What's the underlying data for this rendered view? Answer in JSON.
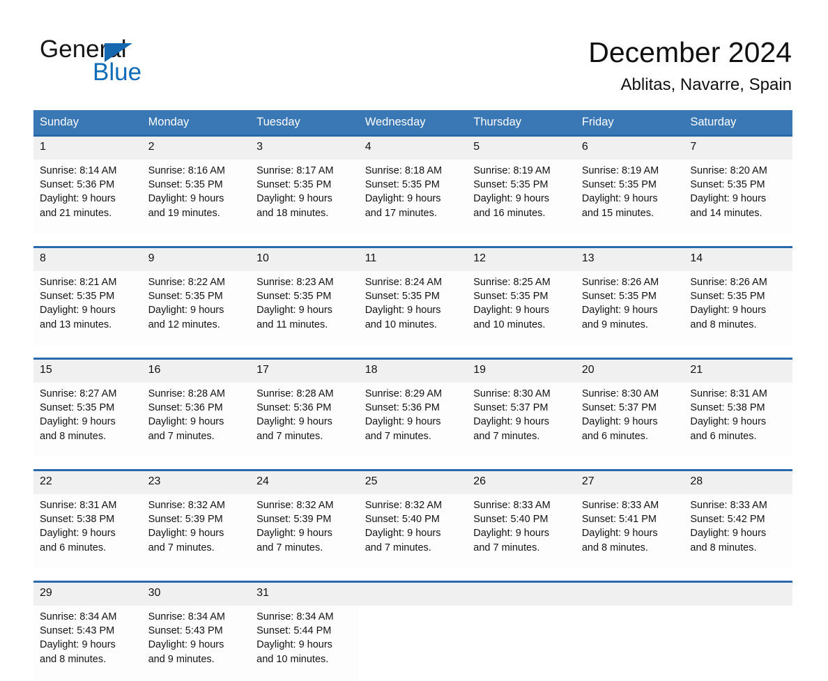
{
  "brand": {
    "name_part1": "General",
    "name_part2": "Blue",
    "triangle_color": "#1568b0",
    "blue_color": "#0f6cb8"
  },
  "header": {
    "title": "December 2024",
    "location": "Ablitas, Navarre, Spain"
  },
  "theme": {
    "header_row_bg": "#3a77b5",
    "week_separator": "#2869ab",
    "daynum_band_bg": "#f0f0f0",
    "cell_bg": "#fdfdfd",
    "text": "#121212"
  },
  "weekdays": [
    "Sunday",
    "Monday",
    "Tuesday",
    "Wednesday",
    "Thursday",
    "Friday",
    "Saturday"
  ],
  "weeks": [
    {
      "days": [
        {
          "date": "1",
          "sunrise": "Sunrise: 8:14 AM",
          "sunset": "Sunset: 5:36 PM",
          "daylight_line1": "Daylight: 9 hours",
          "daylight_line2": "and 21 minutes."
        },
        {
          "date": "2",
          "sunrise": "Sunrise: 8:16 AM",
          "sunset": "Sunset: 5:35 PM",
          "daylight_line1": "Daylight: 9 hours",
          "daylight_line2": "and 19 minutes."
        },
        {
          "date": "3",
          "sunrise": "Sunrise: 8:17 AM",
          "sunset": "Sunset: 5:35 PM",
          "daylight_line1": "Daylight: 9 hours",
          "daylight_line2": "and 18 minutes."
        },
        {
          "date": "4",
          "sunrise": "Sunrise: 8:18 AM",
          "sunset": "Sunset: 5:35 PM",
          "daylight_line1": "Daylight: 9 hours",
          "daylight_line2": "and 17 minutes."
        },
        {
          "date": "5",
          "sunrise": "Sunrise: 8:19 AM",
          "sunset": "Sunset: 5:35 PM",
          "daylight_line1": "Daylight: 9 hours",
          "daylight_line2": "and 16 minutes."
        },
        {
          "date": "6",
          "sunrise": "Sunrise: 8:19 AM",
          "sunset": "Sunset: 5:35 PM",
          "daylight_line1": "Daylight: 9 hours",
          "daylight_line2": "and 15 minutes."
        },
        {
          "date": "7",
          "sunrise": "Sunrise: 8:20 AM",
          "sunset": "Sunset: 5:35 PM",
          "daylight_line1": "Daylight: 9 hours",
          "daylight_line2": "and 14 minutes."
        }
      ]
    },
    {
      "days": [
        {
          "date": "8",
          "sunrise": "Sunrise: 8:21 AM",
          "sunset": "Sunset: 5:35 PM",
          "daylight_line1": "Daylight: 9 hours",
          "daylight_line2": "and 13 minutes."
        },
        {
          "date": "9",
          "sunrise": "Sunrise: 8:22 AM",
          "sunset": "Sunset: 5:35 PM",
          "daylight_line1": "Daylight: 9 hours",
          "daylight_line2": "and 12 minutes."
        },
        {
          "date": "10",
          "sunrise": "Sunrise: 8:23 AM",
          "sunset": "Sunset: 5:35 PM",
          "daylight_line1": "Daylight: 9 hours",
          "daylight_line2": "and 11 minutes."
        },
        {
          "date": "11",
          "sunrise": "Sunrise: 8:24 AM",
          "sunset": "Sunset: 5:35 PM",
          "daylight_line1": "Daylight: 9 hours",
          "daylight_line2": "and 10 minutes."
        },
        {
          "date": "12",
          "sunrise": "Sunrise: 8:25 AM",
          "sunset": "Sunset: 5:35 PM",
          "daylight_line1": "Daylight: 9 hours",
          "daylight_line2": "and 10 minutes."
        },
        {
          "date": "13",
          "sunrise": "Sunrise: 8:26 AM",
          "sunset": "Sunset: 5:35 PM",
          "daylight_line1": "Daylight: 9 hours",
          "daylight_line2": "and 9 minutes."
        },
        {
          "date": "14",
          "sunrise": "Sunrise: 8:26 AM",
          "sunset": "Sunset: 5:35 PM",
          "daylight_line1": "Daylight: 9 hours",
          "daylight_line2": "and 8 minutes."
        }
      ]
    },
    {
      "days": [
        {
          "date": "15",
          "sunrise": "Sunrise: 8:27 AM",
          "sunset": "Sunset: 5:35 PM",
          "daylight_line1": "Daylight: 9 hours",
          "daylight_line2": "and 8 minutes."
        },
        {
          "date": "16",
          "sunrise": "Sunrise: 8:28 AM",
          "sunset": "Sunset: 5:36 PM",
          "daylight_line1": "Daylight: 9 hours",
          "daylight_line2": "and 7 minutes."
        },
        {
          "date": "17",
          "sunrise": "Sunrise: 8:28 AM",
          "sunset": "Sunset: 5:36 PM",
          "daylight_line1": "Daylight: 9 hours",
          "daylight_line2": "and 7 minutes."
        },
        {
          "date": "18",
          "sunrise": "Sunrise: 8:29 AM",
          "sunset": "Sunset: 5:36 PM",
          "daylight_line1": "Daylight: 9 hours",
          "daylight_line2": "and 7 minutes."
        },
        {
          "date": "19",
          "sunrise": "Sunrise: 8:30 AM",
          "sunset": "Sunset: 5:37 PM",
          "daylight_line1": "Daylight: 9 hours",
          "daylight_line2": "and 7 minutes."
        },
        {
          "date": "20",
          "sunrise": "Sunrise: 8:30 AM",
          "sunset": "Sunset: 5:37 PM",
          "daylight_line1": "Daylight: 9 hours",
          "daylight_line2": "and 6 minutes."
        },
        {
          "date": "21",
          "sunrise": "Sunrise: 8:31 AM",
          "sunset": "Sunset: 5:38 PM",
          "daylight_line1": "Daylight: 9 hours",
          "daylight_line2": "and 6 minutes."
        }
      ]
    },
    {
      "days": [
        {
          "date": "22",
          "sunrise": "Sunrise: 8:31 AM",
          "sunset": "Sunset: 5:38 PM",
          "daylight_line1": "Daylight: 9 hours",
          "daylight_line2": "and 6 minutes."
        },
        {
          "date": "23",
          "sunrise": "Sunrise: 8:32 AM",
          "sunset": "Sunset: 5:39 PM",
          "daylight_line1": "Daylight: 9 hours",
          "daylight_line2": "and 7 minutes."
        },
        {
          "date": "24",
          "sunrise": "Sunrise: 8:32 AM",
          "sunset": "Sunset: 5:39 PM",
          "daylight_line1": "Daylight: 9 hours",
          "daylight_line2": "and 7 minutes."
        },
        {
          "date": "25",
          "sunrise": "Sunrise: 8:32 AM",
          "sunset": "Sunset: 5:40 PM",
          "daylight_line1": "Daylight: 9 hours",
          "daylight_line2": "and 7 minutes."
        },
        {
          "date": "26",
          "sunrise": "Sunrise: 8:33 AM",
          "sunset": "Sunset: 5:40 PM",
          "daylight_line1": "Daylight: 9 hours",
          "daylight_line2": "and 7 minutes."
        },
        {
          "date": "27",
          "sunrise": "Sunrise: 8:33 AM",
          "sunset": "Sunset: 5:41 PM",
          "daylight_line1": "Daylight: 9 hours",
          "daylight_line2": "and 8 minutes."
        },
        {
          "date": "28",
          "sunrise": "Sunrise: 8:33 AM",
          "sunset": "Sunset: 5:42 PM",
          "daylight_line1": "Daylight: 9 hours",
          "daylight_line2": "and 8 minutes."
        }
      ]
    },
    {
      "days": [
        {
          "date": "29",
          "sunrise": "Sunrise: 8:34 AM",
          "sunset": "Sunset: 5:43 PM",
          "daylight_line1": "Daylight: 9 hours",
          "daylight_line2": "and 8 minutes."
        },
        {
          "date": "30",
          "sunrise": "Sunrise: 8:34 AM",
          "sunset": "Sunset: 5:43 PM",
          "daylight_line1": "Daylight: 9 hours",
          "daylight_line2": "and 9 minutes."
        },
        {
          "date": "31",
          "sunrise": "Sunrise: 8:34 AM",
          "sunset": "Sunset: 5:44 PM",
          "daylight_line1": "Daylight: 9 hours",
          "daylight_line2": "and 10 minutes."
        },
        {
          "date": "",
          "sunrise": "",
          "sunset": "",
          "daylight_line1": "",
          "daylight_line2": ""
        },
        {
          "date": "",
          "sunrise": "",
          "sunset": "",
          "daylight_line1": "",
          "daylight_line2": ""
        },
        {
          "date": "",
          "sunrise": "",
          "sunset": "",
          "daylight_line1": "",
          "daylight_line2": ""
        },
        {
          "date": "",
          "sunrise": "",
          "sunset": "",
          "daylight_line1": "",
          "daylight_line2": ""
        }
      ]
    }
  ]
}
